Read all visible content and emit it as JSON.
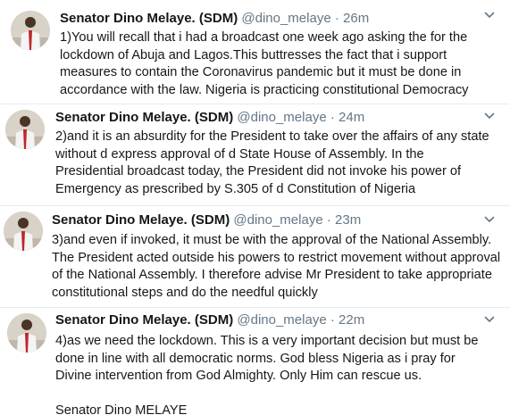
{
  "author": {
    "display_name": "Senator Dino Melaye. (SDM)",
    "handle": "@dino_melaye",
    "separator": "·"
  },
  "icons": {
    "avatar": "profile-photo",
    "menu": "chevron-down-icon"
  },
  "colors": {
    "text": "#14171a",
    "secondary": "#657786",
    "divider": "#e6ecf0"
  },
  "tweets": [
    {
      "timestamp": "26m",
      "text": "1)You will recall that i had a broadcast one week ago asking the for the lockdown of Abuja and Lagos.This buttresses the fact that i support measures to contain the Coronavirus pandemic but it must be done in accordance with the law. Nigeria is practicing constitutional Democracy"
    },
    {
      "timestamp": "24m",
      "text": "2)and it is an absurdity for the President to take over the affairs of any state without d express approval of d State House of Assembly. In the Presidential broadcast today, the President did not invoke his power of Emergency as prescribed by S.305 of d Constitution of Nigeria"
    },
    {
      "timestamp": "23m",
      "text": "3)and even if invoked, it must be with the approval of the National Assembly. The President acted outside his powers to restrict movement without approval of the National Assembly. I therefore advise Mr President to take appropriate constitutional steps and do the needful quickly"
    },
    {
      "timestamp": "22m",
      "text": "4)as we need the lockdown. This is a very important decision but must be done in line with all democratic norms. God bless Nigeria as i pray for Divine intervention from God Almighty. Only Him can rescue us.\n\nSenator Dino MELAYE"
    }
  ]
}
